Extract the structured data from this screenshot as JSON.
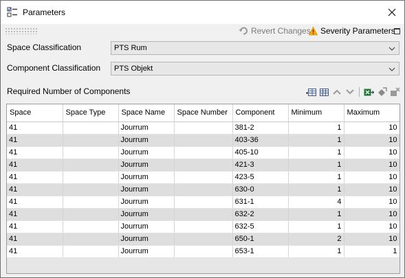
{
  "window": {
    "title": "Parameters"
  },
  "toolbar": {
    "revert_label": "Revert Changes",
    "severity_label": "Severity Parameters"
  },
  "space_classification": {
    "label": "Space Classification",
    "value": "PTS Rum"
  },
  "component_classification": {
    "label": "Component Classification",
    "value": "PTS Objekt"
  },
  "section": {
    "title": "Required Number of Components"
  },
  "table": {
    "columns": [
      "Space",
      "Space Type",
      "Space Name",
      "Space Number",
      "Component",
      "Minimum",
      "Maximum"
    ],
    "rows": [
      [
        "41",
        "",
        "Jourrum",
        "",
        "381-2",
        "1",
        "10"
      ],
      [
        "41",
        "",
        "Jourrum",
        "",
        "403-36",
        "1",
        "10"
      ],
      [
        "41",
        "",
        "Jourrum",
        "",
        "405-10",
        "1",
        "10"
      ],
      [
        "41",
        "",
        "Jourrum",
        "",
        "421-3",
        "1",
        "10"
      ],
      [
        "41",
        "",
        "Jourrum",
        "",
        "423-5",
        "1",
        "10"
      ],
      [
        "41",
        "",
        "Jourrum",
        "",
        "630-0",
        "1",
        "10"
      ],
      [
        "41",
        "",
        "Jourrum",
        "",
        "631-1",
        "4",
        "10"
      ],
      [
        "41",
        "",
        "Jourrum",
        "",
        "632-2",
        "1",
        "10"
      ],
      [
        "41",
        "",
        "Jourrum",
        "",
        "632-5",
        "1",
        "10"
      ],
      [
        "41",
        "",
        "Jourrum",
        "",
        "650-1",
        "2",
        "10"
      ],
      [
        "41",
        "",
        "Jourrum",
        "",
        "653-1",
        "1",
        "1"
      ]
    ]
  },
  "icons": [
    "parameters-icon",
    "close-icon",
    "revert-icon",
    "warning-icon",
    "maximize-icon",
    "chevron-down-icon",
    "add-row-icon",
    "add-rows-icon",
    "move-up-icon",
    "move-down-icon",
    "export-excel-icon",
    "refresh-icon",
    "delete-icon"
  ],
  "colors": {
    "warning": "#f2b400",
    "excel_green": "#1e7b34",
    "row_alt": "#dedede"
  }
}
